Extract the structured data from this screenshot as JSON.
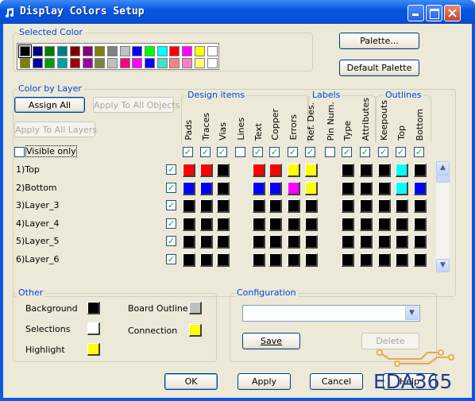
{
  "window": {
    "title": "Display Colors Setup"
  },
  "selected_color": {
    "legend": "Selected Color",
    "palette_row1": [
      "#000000",
      "#000080",
      "#008000",
      "#008080",
      "#800000",
      "#800080",
      "#808000",
      "#808080",
      "#c0c0c0",
      "#0000ff",
      "#00ff00",
      "#00ffff",
      "#ff0000",
      "#ff00ff",
      "#ffff00",
      "#ffffff"
    ],
    "palette_row2": [
      "#808000",
      "#0000a0",
      "#00a000",
      "#00a0a0",
      "#a00000",
      "#a000a0",
      "#808040",
      "#c0c0c0",
      "#ff0080",
      "#ff00ff",
      "#0000ff",
      "#40e0d0",
      "#ff8080",
      "#ff80c0",
      "#ffff80",
      "#ffffff"
    ]
  },
  "buttons": {
    "palette": "Palette...",
    "default_palette": "Default Palette",
    "assign_all": "Assign All",
    "apply_to_all_objects": "Apply To All Objects",
    "apply_to_all_layers": "Apply To All Layers",
    "save": "Save",
    "delete": "Delete",
    "ok": "OK",
    "apply": "Apply",
    "cancel": "Cancel",
    "help": "Help"
  },
  "color_by_layer": {
    "legend": "Color by Layer",
    "visible_only_label": "Visible only",
    "groups": {
      "design_items": "Design items",
      "labels": "Labels",
      "outlines": "Outlines"
    },
    "columns": [
      "Pads",
      "Traces",
      "Vias",
      "Lines",
      "Text",
      "Copper",
      "Errors",
      "Ref. Des.",
      "Pin Num.",
      "Type",
      "Attributes",
      "Keepouts",
      "Top",
      "Bottom"
    ],
    "column_checks": [
      true,
      true,
      true,
      false,
      true,
      true,
      true,
      true,
      false,
      true,
      true,
      true,
      true,
      true
    ],
    "layers": [
      {
        "name": "1)Top",
        "checked": true,
        "colors": [
          "#ff0000",
          "#ff0000",
          "#000000",
          "",
          "#ff0000",
          "#ff0000",
          "#ffff00",
          "#ffff00",
          "",
          "#000000",
          "#000000",
          "#000000",
          "#00ffff",
          "#000000"
        ]
      },
      {
        "name": "2)Bottom",
        "checked": true,
        "colors": [
          "#0000ff",
          "#0000ff",
          "#000000",
          "",
          "#0000ff",
          "#0000ff",
          "#ff00ff",
          "#ffff00",
          "",
          "#000000",
          "#000000",
          "#000000",
          "#00ffff",
          "#0000ff"
        ]
      },
      {
        "name": "3)Layer_3",
        "checked": true,
        "colors": [
          "#000000",
          "#000000",
          "#000000",
          "",
          "#000000",
          "#000000",
          "#000000",
          "#000000",
          "",
          "#000000",
          "#000000",
          "#000000",
          "#000000",
          "#000000"
        ]
      },
      {
        "name": "4)Layer_4",
        "checked": true,
        "colors": [
          "#000000",
          "#000000",
          "#000000",
          "",
          "#000000",
          "#000000",
          "#000000",
          "#000000",
          "",
          "#000000",
          "#000000",
          "#000000",
          "#000000",
          "#000000"
        ]
      },
      {
        "name": "5)Layer_5",
        "checked": true,
        "colors": [
          "#000000",
          "#000000",
          "#000000",
          "",
          "#000000",
          "#000000",
          "#000000",
          "#000000",
          "",
          "#000000",
          "#000000",
          "#000000",
          "#000000",
          "#000000"
        ]
      },
      {
        "name": "6)Layer_6",
        "checked": true,
        "colors": [
          "#000000",
          "#000000",
          "#000000",
          "",
          "#000000",
          "#000000",
          "#000000",
          "#000000",
          "",
          "#000000",
          "#000000",
          "#000000",
          "#000000",
          "#000000"
        ]
      }
    ]
  },
  "other": {
    "legend": "Other",
    "items": [
      {
        "label": "Background",
        "color": "#000000"
      },
      {
        "label": "Selections",
        "color": "#ffffff"
      },
      {
        "label": "Highlight",
        "color": "#ffff00"
      },
      {
        "label": "Board Outline",
        "color": "#c0c0c0"
      },
      {
        "label": "Connection",
        "color": "#ffff00"
      }
    ]
  },
  "configuration": {
    "legend": "Configuration",
    "value": ""
  },
  "watermark": {
    "text": "EDA365"
  }
}
